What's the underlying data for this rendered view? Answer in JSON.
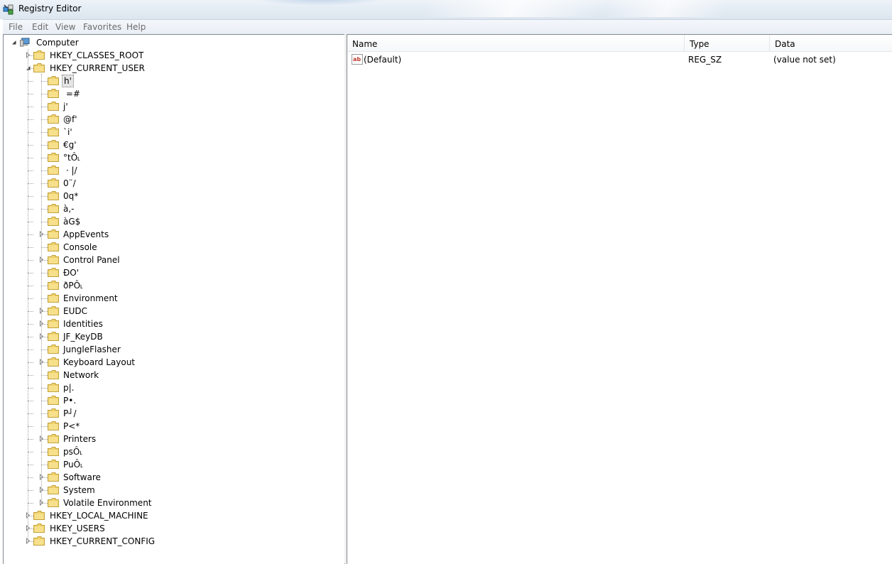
{
  "window": {
    "title": "Registry Editor",
    "icon": "registry-editor-icon"
  },
  "menu": [
    "File",
    "Edit",
    "View",
    "Favorites",
    "Help"
  ],
  "tree": {
    "root": "Computer",
    "hives_before": [
      {
        "label": "HKEY_CLASSES_ROOT",
        "expander": "collapsed"
      },
      {
        "label": "HKEY_CURRENT_USER",
        "expander": "expanded"
      }
    ],
    "current_user_children": [
      {
        "label": "h'",
        "expander": "none",
        "selected": true
      },
      {
        "label": " =#",
        "expander": "none"
      },
      {
        "label": "j'",
        "expander": "none"
      },
      {
        "label": "@f'",
        "expander": "none"
      },
      {
        "label": "`i'",
        "expander": "none"
      },
      {
        "label": "€g'",
        "expander": "none"
      },
      {
        "label": "°tÔ˪",
        "expander": "none"
      },
      {
        "label": " · |/",
        "expander": "none"
      },
      {
        "label": "0¨/",
        "expander": "none"
      },
      {
        "label": "0q*",
        "expander": "none"
      },
      {
        "label": "à,-",
        "expander": "none"
      },
      {
        "label": "àG$",
        "expander": "none"
      },
      {
        "label": "AppEvents",
        "expander": "collapsed"
      },
      {
        "label": "Console",
        "expander": "none"
      },
      {
        "label": "Control Panel",
        "expander": "collapsed"
      },
      {
        "label": "ÐO'",
        "expander": "none"
      },
      {
        "label": "ðPÔ˪",
        "expander": "none"
      },
      {
        "label": "Environment",
        "expander": "none"
      },
      {
        "label": "EUDC",
        "expander": "collapsed"
      },
      {
        "label": "Identities",
        "expander": "collapsed"
      },
      {
        "label": "JF_KeyDB",
        "expander": "collapsed"
      },
      {
        "label": "JungleFlasher",
        "expander": "none"
      },
      {
        "label": "Keyboard Layout",
        "expander": "collapsed"
      },
      {
        "label": "Network",
        "expander": "none"
      },
      {
        "label": "p|.",
        "expander": "none"
      },
      {
        "label": "P•.",
        "expander": "none"
      },
      {
        "label": "P┘/",
        "expander": "none"
      },
      {
        "label": "P<*",
        "expander": "none"
      },
      {
        "label": "Printers",
        "expander": "collapsed"
      },
      {
        "label": "psÔ˪",
        "expander": "none"
      },
      {
        "label": "PuÔ˪",
        "expander": "none"
      },
      {
        "label": "Software",
        "expander": "collapsed"
      },
      {
        "label": "System",
        "expander": "collapsed"
      },
      {
        "label": "Volatile Environment",
        "expander": "collapsed"
      }
    ],
    "hives_after": [
      {
        "label": "HKEY_LOCAL_MACHINE",
        "expander": "collapsed"
      },
      {
        "label": "HKEY_USERS",
        "expander": "collapsed"
      },
      {
        "label": "HKEY_CURRENT_CONFIG",
        "expander": "collapsed"
      }
    ]
  },
  "values_list": {
    "columns": [
      "Name",
      "Type",
      "Data"
    ],
    "rows": [
      {
        "name": "(Default)",
        "type": "REG_SZ",
        "data": "(value not set)",
        "icon": "string-value-icon"
      }
    ]
  }
}
